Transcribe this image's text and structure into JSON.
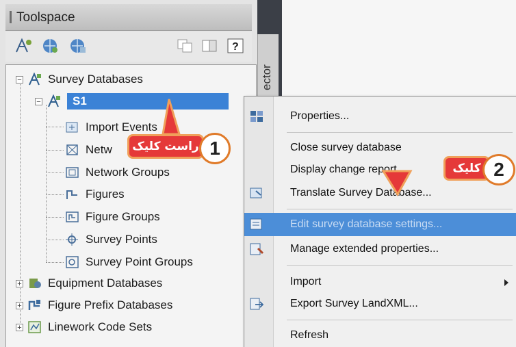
{
  "toolspace": {
    "title": "Toolspace",
    "side_tab_label": "ector"
  },
  "tree": {
    "items": [
      {
        "label": "Survey Databases",
        "icon": "survey-db-icon"
      },
      {
        "label": "S1",
        "icon": "survey-db-icon",
        "selected": true
      },
      {
        "label": "Import Events",
        "icon": "import-events-icon"
      },
      {
        "label": "Netw",
        "icon": "networks-icon"
      },
      {
        "label": "Network Groups",
        "icon": "network-groups-icon"
      },
      {
        "label": "Figures",
        "icon": "figures-icon"
      },
      {
        "label": "Figure Groups",
        "icon": "figure-groups-icon"
      },
      {
        "label": "Survey Points",
        "icon": "survey-points-icon"
      },
      {
        "label": "Survey Point Groups",
        "icon": "survey-point-groups-icon"
      },
      {
        "label": "Equipment Databases",
        "icon": "equipment-db-icon"
      },
      {
        "label": "Figure Prefix Databases",
        "icon": "figure-prefix-db-icon"
      },
      {
        "label": "Linework Code Sets",
        "icon": "linework-code-icon"
      }
    ]
  },
  "context_menu": {
    "items": [
      {
        "label": "Properties...",
        "icon": "properties-icon"
      },
      {
        "label": "Close survey database"
      },
      {
        "label": "Display change report..."
      },
      {
        "label": "Translate Survey Database...",
        "icon": "translate-icon"
      },
      {
        "label": "Edit survey database settings...",
        "icon": "edit-settings-icon",
        "highlighted": true
      },
      {
        "label": "Manage extended properties...",
        "icon": "manage-props-icon"
      },
      {
        "label": "Import",
        "submenu": true
      },
      {
        "label": "Export Survey LandXML...",
        "icon": "export-icon"
      },
      {
        "label": "Refresh"
      }
    ]
  },
  "callouts": {
    "step1": {
      "number": "1",
      "text": "راست کلیک"
    },
    "step2": {
      "number": "2",
      "text": "کلیک"
    }
  },
  "colors": {
    "selection": "#3b82d6",
    "menu_highlight": "#4c8ed8",
    "callout_fill": "#e53939",
    "callout_border": "#e07b2a"
  }
}
